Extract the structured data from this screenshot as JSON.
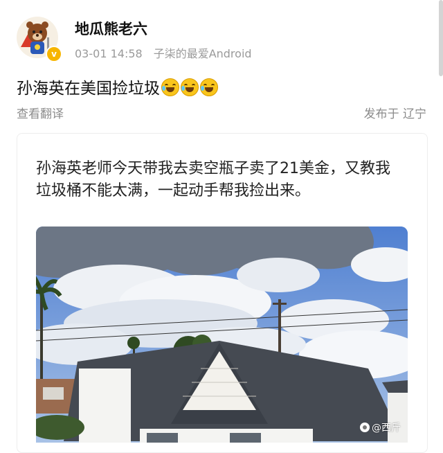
{
  "post": {
    "username": "地瓜熊老六",
    "timestamp": "03-01 14:58",
    "source": "子柒的最爱Android",
    "text": "孙海英在美国捡垃圾",
    "emoji_count": 3,
    "translate_label": "查看翻译",
    "location": "发布于 辽宁"
  },
  "card": {
    "text": "孙海英老师今天带我去卖空瓶子卖了21美金，又教我垃圾桶不能太满，一起动手帮我捡出来。"
  },
  "watermark": {
    "text": "@西斤"
  },
  "icons": {
    "verified": "verified-badge-icon",
    "emoji": "laugh-cry-emoji-icon",
    "watermark": "weibo-logo-icon"
  },
  "colors": {
    "verified": "#f7b500",
    "meta_text": "#9a9a9a",
    "sky": "#6f94cf"
  }
}
